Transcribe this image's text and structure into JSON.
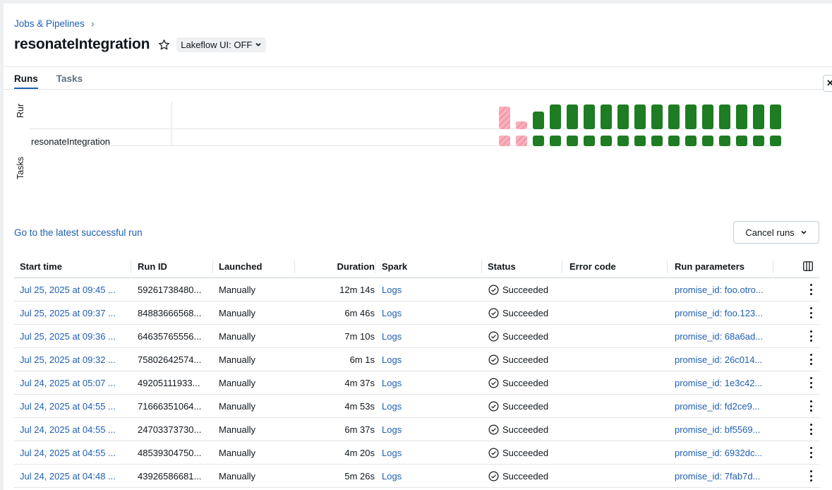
{
  "breadcrumb": {
    "parent": "Jobs & Pipelines",
    "separator": "›"
  },
  "header": {
    "title": "resonateIntegration",
    "lakeflow_toggle": "Lakeflow UI: OFF"
  },
  "tabs": [
    {
      "label": "Runs",
      "active": true
    },
    {
      "label": "Tasks",
      "active": false
    }
  ],
  "matrix": {
    "runs_axis_label": "Rur",
    "tasks_axis_label": "Tasks",
    "task_name": "resonateIntegration",
    "run_bars": [
      {
        "status": "failed",
        "relative_duration": 0.91
      },
      {
        "status": "failed",
        "relative_duration": 0.32
      },
      {
        "status": "succeeded",
        "relative_duration": 0.7
      },
      {
        "status": "succeeded",
        "relative_duration": 1.0
      },
      {
        "status": "succeeded",
        "relative_duration": 1.0
      },
      {
        "status": "succeeded",
        "relative_duration": 1.0
      },
      {
        "status": "succeeded",
        "relative_duration": 1.0
      },
      {
        "status": "succeeded",
        "relative_duration": 1.0
      },
      {
        "status": "succeeded",
        "relative_duration": 1.0
      },
      {
        "status": "succeeded",
        "relative_duration": 1.0
      },
      {
        "status": "succeeded",
        "relative_duration": 1.0
      },
      {
        "status": "succeeded",
        "relative_duration": 1.0
      },
      {
        "status": "succeeded",
        "relative_duration": 1.0
      },
      {
        "status": "succeeded",
        "relative_duration": 1.0
      },
      {
        "status": "succeeded",
        "relative_duration": 1.0
      },
      {
        "status": "succeeded",
        "relative_duration": 1.0
      },
      {
        "status": "succeeded",
        "relative_duration": 1.0
      }
    ]
  },
  "actions": {
    "latest_link": "Go to the latest successful run",
    "cancel_runs": "Cancel runs"
  },
  "table": {
    "columns": [
      "Start time",
      "Run ID",
      "Launched",
      "Duration",
      "Spark",
      "Status",
      "Error code",
      "Run parameters"
    ],
    "rows": [
      {
        "start": "Jul 25, 2025 at 09:45 ...",
        "run_id": "59261738480...",
        "launched": "Manually",
        "duration": "12m 14s",
        "spark": "Logs",
        "status": "Succeeded",
        "error": "",
        "params": "promise_id: foo.otro..."
      },
      {
        "start": "Jul 25, 2025 at 09:37 ...",
        "run_id": "84883666568...",
        "launched": "Manually",
        "duration": "6m 46s",
        "spark": "Logs",
        "status": "Succeeded",
        "error": "",
        "params": "promise_id: foo.123..."
      },
      {
        "start": "Jul 25, 2025 at 09:36 ...",
        "run_id": "64635765556...",
        "launched": "Manually",
        "duration": "7m 10s",
        "spark": "Logs",
        "status": "Succeeded",
        "error": "",
        "params": "promise_id: 68a6ad..."
      },
      {
        "start": "Jul 25, 2025 at 09:32 ...",
        "run_id": "75802642574...",
        "launched": "Manually",
        "duration": "6m 1s",
        "spark": "Logs",
        "status": "Succeeded",
        "error": "",
        "params": "promise_id: 26c014..."
      },
      {
        "start": "Jul 24, 2025 at 05:07 ...",
        "run_id": "49205111933...",
        "launched": "Manually",
        "duration": "4m 37s",
        "spark": "Logs",
        "status": "Succeeded",
        "error": "",
        "params": "promise_id: 1e3c42..."
      },
      {
        "start": "Jul 24, 2025 at 04:55 ...",
        "run_id": "71666351064...",
        "launched": "Manually",
        "duration": "4m 53s",
        "spark": "Logs",
        "status": "Succeeded",
        "error": "",
        "params": "promise_id: fd2ce9..."
      },
      {
        "start": "Jul 24, 2025 at 04:55 ...",
        "run_id": "24703373730...",
        "launched": "Manually",
        "duration": "6m 37s",
        "spark": "Logs",
        "status": "Succeeded",
        "error": "",
        "params": "promise_id: bf5569..."
      },
      {
        "start": "Jul 24, 2025 at 04:55 ...",
        "run_id": "48539304750...",
        "launched": "Manually",
        "duration": "4m 20s",
        "spark": "Logs",
        "status": "Succeeded",
        "error": "",
        "params": "promise_id: 6932dc..."
      },
      {
        "start": "Jul 24, 2025 at 04:48 ...",
        "run_id": "43926586681...",
        "launched": "Manually",
        "duration": "5m 26s",
        "spark": "Logs",
        "status": "Succeeded",
        "error": "",
        "params": "promise_id: 7fab7d..."
      }
    ]
  }
}
